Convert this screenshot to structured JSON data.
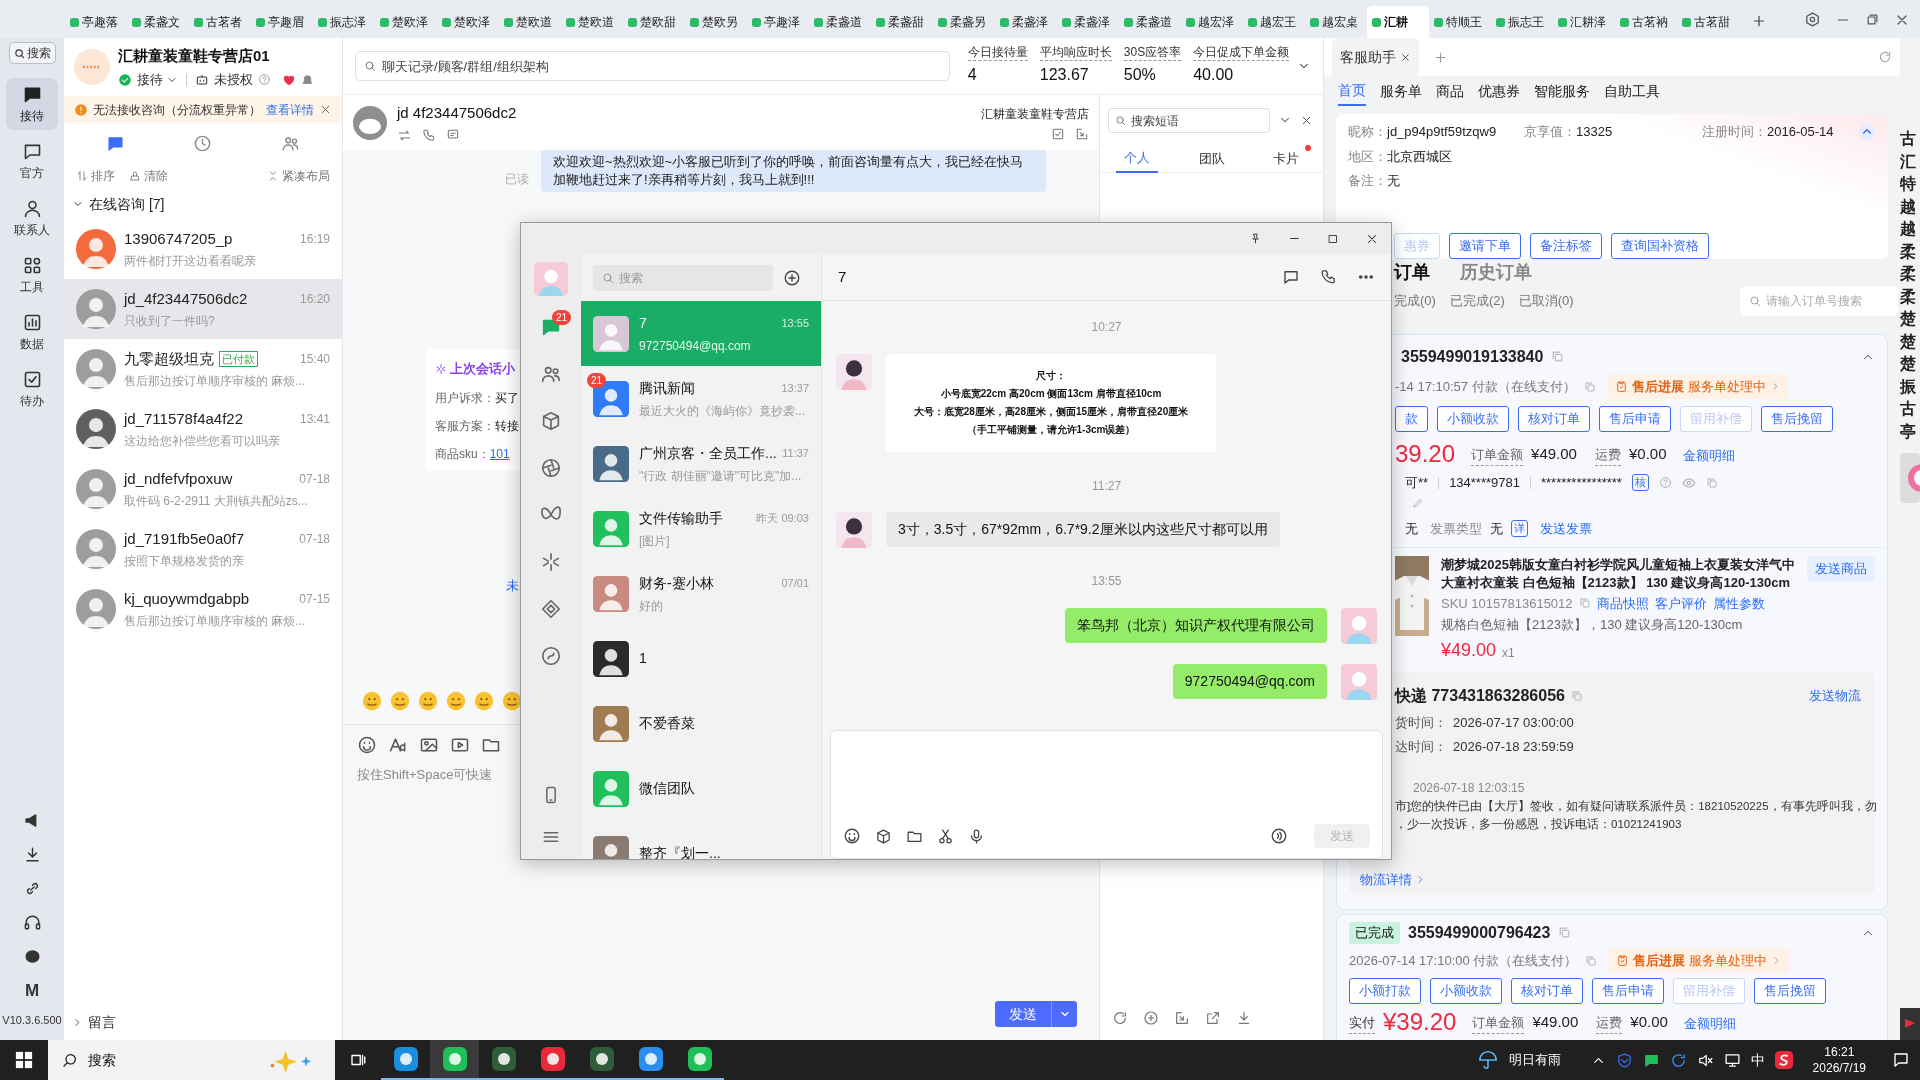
{
  "top_tabs": [
    {
      "label": "亭趣落",
      "selected": false
    },
    {
      "label": "柔盏文",
      "selected": false
    },
    {
      "label": "古茗者",
      "selected": false
    },
    {
      "label": "亭趣眉",
      "selected": false
    },
    {
      "label": "振志泽",
      "selected": false
    },
    {
      "label": "楚欧泽",
      "selected": false
    },
    {
      "label": "楚欧泽",
      "selected": false
    },
    {
      "label": "楚欧道",
      "selected": false
    },
    {
      "label": "楚欧道",
      "selected": false
    },
    {
      "label": "楚欧甜",
      "selected": false
    },
    {
      "label": "楚欧另",
      "selected": false
    },
    {
      "label": "亭趣泽",
      "selected": false
    },
    {
      "label": "柔盏道",
      "selected": false
    },
    {
      "label": "柔盏甜",
      "selected": false
    },
    {
      "label": "柔盏另",
      "selected": false
    },
    {
      "label": "柔盏泽",
      "selected": false
    },
    {
      "label": "柔盏泽",
      "selected": false
    },
    {
      "label": "柔盏道",
      "selected": false
    },
    {
      "label": "越宏泽",
      "selected": false
    },
    {
      "label": "越宏王",
      "selected": false
    },
    {
      "label": "越宏桌",
      "selected": false
    },
    {
      "label": "汇耕",
      "selected": true
    },
    {
      "label": "特顺王",
      "selected": false
    },
    {
      "label": "振志王",
      "selected": false
    },
    {
      "label": "汇耕泽",
      "selected": false
    },
    {
      "label": "古茗衲",
      "selected": false
    },
    {
      "label": "古茗甜",
      "selected": false
    }
  ],
  "rail": {
    "search": "搜索",
    "items": [
      {
        "label": "接待",
        "selected": true
      },
      {
        "label": "官方",
        "selected": false
      },
      {
        "label": "联系人",
        "selected": false
      },
      {
        "label": "工具",
        "selected": false
      },
      {
        "label": "数据",
        "selected": false
      },
      {
        "label": "待办",
        "selected": false
      }
    ],
    "logo_letter": "M",
    "version": "V10.3.6.500"
  },
  "shop": {
    "name": "汇耕童装童鞋专营店01",
    "status": "接待",
    "auth": "未授权"
  },
  "alert": {
    "text": "无法接收咨询（分流权重异常）",
    "link": "查看详情"
  },
  "list_tabs": [
    {
      "selected": true
    },
    {
      "selected": false
    },
    {
      "selected": false
    }
  ],
  "list_actions": [
    "排序",
    "清除",
    "紧凑布局"
  ],
  "section": {
    "label": "在线咨询 [7]",
    "expanded": true
  },
  "conversations": [
    {
      "name": "13906747205_p",
      "time": "16:19",
      "preview": "两件都打开这边看看呢亲",
      "selected": false,
      "color": "#f46a3c"
    },
    {
      "name": "jd_4f23447506dc2",
      "time": "16:20",
      "preview": "只收到了一件吗?",
      "selected": true,
      "color": "#9d9d9d"
    },
    {
      "name": "九零超级坦克",
      "tag": "已付款",
      "time": "15:40",
      "preview": "售后那边按订单顺序审核的 麻烦...",
      "selected": false,
      "color": "#9d9d9d"
    },
    {
      "name": "jd_711578f4a4f22",
      "time": "13:41",
      "preview": "这边给您补偿些您看可以吗亲",
      "selected": false,
      "color": "#5f5f5f"
    },
    {
      "name": "jd_ndfefvfpoxuw",
      "time": "07-18",
      "preview": "取件码 6-2-2911 大荆镇共配站zs...",
      "selected": false,
      "color": "#9d9d9d"
    },
    {
      "name": "jd_7191fb5e0a0f7",
      "time": "07-18",
      "preview": "按照下单规格发货的亲",
      "selected": false,
      "color": "#9d9d9d"
    },
    {
      "name": "kj_quoywmdgabpb",
      "time": "07-15",
      "preview": "售后那边按订单顺序审核的 麻烦...",
      "selected": false,
      "color": "#9d9d9d"
    }
  ],
  "leave_message": "留言",
  "top_search": {
    "placeholder": "聊天记录/顾客/群组/组织架构"
  },
  "stats": [
    {
      "label": "今日接待量",
      "value": "4"
    },
    {
      "label": "平均响应时长",
      "value": "123.67"
    },
    {
      "label": "30S应答率",
      "value": "50%"
    },
    {
      "label": "今日促成下单金额",
      "value": "40.00"
    }
  ],
  "chat": {
    "customer": "jd 4f23447506dc2",
    "shop": "汇耕童装童鞋专营店",
    "welcome": "欢迎欢迎~热烈欢迎~小客服已听到了你的呼唤，前面咨询量有点大，我已经在快马加鞭地赶过来了!亲再稍等片刻，我马上就到!!!",
    "read": "已读",
    "last_session": {
      "title": "上次会话小",
      "lines": [
        {
          "label": "用户诉求：",
          "value": "买了"
        },
        {
          "label": "客服方案：",
          "value": "转接"
        },
        {
          "label": "商品sku：",
          "value": "101"
        }
      ]
    },
    "fragment": "未",
    "placeholder": "按住Shift+Space可快速",
    "send": "发送"
  },
  "quick": {
    "placeholder": "搜索短语",
    "tabs": [
      {
        "label": "个人",
        "selected": true,
        "badge": false
      },
      {
        "label": "团队",
        "selected": false,
        "badge": false
      },
      {
        "label": "卡片",
        "selected": false,
        "badge": true
      }
    ]
  },
  "assistant": {
    "tab": "客服助手",
    "nav": [
      {
        "label": "首页",
        "selected": true
      },
      {
        "label": "服务单",
        "selected": false
      },
      {
        "label": "商品",
        "selected": false
      },
      {
        "label": "优惠券",
        "selected": false
      },
      {
        "label": "智能服务",
        "selected": false
      },
      {
        "label": "自助工具",
        "selected": false
      }
    ],
    "profile": [
      {
        "label": "昵称：",
        "value": "jd_p94p9tf59tzqw9"
      },
      {
        "label": "京享值：",
        "value": "13325"
      },
      {
        "label": "注册时间：",
        "value": "2016-05-14"
      },
      {
        "label": "地区：",
        "value": "北京西城区"
      },
      {
        "label": "备注：",
        "value": "无"
      }
    ],
    "actions": [
      "惠券",
      "邀请下单",
      "备注标签",
      "查询国补资格"
    ],
    "order_tabs": [
      {
        "label": "订单",
        "selected": true
      },
      {
        "label": "历史订单",
        "selected": false
      }
    ],
    "filters": [
      "完成(0)",
      "已完成(2)",
      "已取消(0)"
    ],
    "order_search": {
      "placeholder": "请输入订单号搜索"
    },
    "orders": [
      {
        "number": "3559499019133840",
        "paid": "-14 17:10:57 付款（在线支付）",
        "progress": {
          "label": "售后进展",
          "value": "服务单处理中"
        },
        "buttons": [
          {
            "label": "款",
            "disabled": false
          },
          {
            "label": "小额收款",
            "disabled": false
          },
          {
            "label": "核对订单",
            "disabled": false
          },
          {
            "label": "售后申请",
            "disabled": false
          },
          {
            "label": "留用补偿",
            "disabled": true
          },
          {
            "label": "售后挽留",
            "disabled": false
          }
        ],
        "amount": "39.20",
        "total_label": "订单金额",
        "total": "¥49.00",
        "freight_label": "运费",
        "freight": "¥0.00",
        "detail": "金额明细",
        "contact": {
          "name": "可**",
          "phone": "134****9781",
          "address": "****************",
          "verify": "核"
        },
        "invoice": {
          "value": "无",
          "type_label": "发票类型",
          "type": "无",
          "detail": "详",
          "send": "发送发票"
        },
        "product": {
          "title": "潮梦城2025韩版女童白衬衫学院风儿童短袖上衣夏装女洋气中大童衬衣童装 白色短袖【2123款】 130 建议身高120-130cm",
          "send": "发送商品",
          "sku": "SKU 10157813615012",
          "links": [
            "商品快照",
            "客户评价",
            "属性参数"
          ],
          "spec": "规格白色短袖【2123款】，130 建议身高120-130cm",
          "price": "¥49.00",
          "qty": "x1"
        },
        "logistics": {
          "title": "快递 773431863286056",
          "send": "发送物流",
          "rows": [
            {
              "label": "货时间：",
              "value": "2026-07-17 03:00:00"
            },
            {
              "label": "达时间：",
              "value": "2026-07-18 23:59:59"
            }
          ],
          "latest_time": "2026-07-18 12:03:15",
          "latest": [
            "市]您的快件已由【大厅】签收，如有疑问请联系派件员：18210520225，有事先呼叫我，勿",
            "，少一次投诉，多一份感恩，投诉电话：01021241903"
          ],
          "more": "物流详情"
        }
      },
      {
        "status": "已完成",
        "number": "3559499000796423",
        "paid": "2026-07-14 17:10:00 付款（在线支付）",
        "progress": {
          "label": "售后进展",
          "value": "服务单处理中"
        },
        "buttons": [
          {
            "label": "小额打款",
            "disabled": false
          },
          {
            "label": "小额收款",
            "disabled": false
          },
          {
            "label": "核对订单",
            "disabled": false
          },
          {
            "label": "售后申请",
            "disabled": false
          },
          {
            "label": "留用补偿",
            "disabled": true
          },
          {
            "label": "售后挽留",
            "disabled": false
          }
        ],
        "amount_label": "实付",
        "amount": "¥39.20",
        "total_label": "订单金额",
        "total": "¥49.00",
        "freight_label": "运费",
        "freight": "¥0.00",
        "detail": "金额明细"
      }
    ]
  },
  "edge_tabs": [
    "古",
    "汇",
    "特",
    "越",
    "越",
    "柔",
    "柔",
    "柔",
    "楚",
    "楚",
    "楚",
    "振",
    "古",
    "亭"
  ],
  "wechat": {
    "rail": [
      {
        "selected": true,
        "badge": "21"
      },
      {
        "selected": false
      },
      {
        "selected": false
      },
      {
        "selected": false
      },
      {
        "selected": false
      },
      {
        "selected": false
      },
      {
        "selected": false
      },
      {
        "selected": false
      }
    ],
    "search": {
      "placeholder": "搜索"
    },
    "chats": [
      {
        "name": "7",
        "time": "13:55",
        "preview": "972750494@qq.com",
        "selected": true,
        "color": "#d9c7d8"
      },
      {
        "name": "腾讯新闻",
        "time": "13:37",
        "preview": "最近大火的《海屿你》竟抄袭...",
        "selected": false,
        "badge": "21",
        "color": "#2f7cf6"
      },
      {
        "name": "广州京客・全员工作...",
        "time": "11:37",
        "preview": "\"行政 胡佳丽\"邀请\"可比克\"加...",
        "selected": false,
        "color": "#4a6a8a"
      },
      {
        "name": "文件传输助手",
        "time": "昨天 09:03",
        "preview": "[图片]",
        "selected": false,
        "color": "#20c05c"
      },
      {
        "name": "财务-蹇小林",
        "time": "07/01",
        "preview": "好的",
        "selected": false,
        "color": "#c98a80"
      },
      {
        "name": "1",
        "selected": false,
        "color": "#2a2a2a"
      },
      {
        "name": "不爱香菜",
        "selected": false,
        "color": "#a07a50"
      },
      {
        "name": "微信团队",
        "selected": false,
        "color": "#20c05c"
      },
      {
        "name": "整齐『划一...",
        "selected": false,
        "color": "#8a7a70"
      }
    ],
    "title": "7",
    "messages": [
      {
        "kind": "time",
        "text": "10:27"
      },
      {
        "kind": "card",
        "outgoing": false,
        "lines": [
          "尺寸：",
          "小号底宽22cm 高20cm 侧面13cm 肩带直径10cm",
          "大号：底宽28厘米，高28厘米，侧面15厘米，肩带直径20厘米",
          "（手工平铺测量，请允许1-3cm误差）"
        ]
      },
      {
        "kind": "time",
        "text": "11:27"
      },
      {
        "kind": "text",
        "outgoing": false,
        "text": "3寸，3.5寸，67*92mm，6.7*9.2厘米以内这些尺寸都可以用"
      },
      {
        "kind": "time",
        "text": "13:55"
      },
      {
        "kind": "text",
        "outgoing": true,
        "text": "笨鸟邦（北京）知识产权代理有限公司"
      },
      {
        "kind": "text",
        "outgoing": true,
        "text": "972750494@qq.com"
      }
    ],
    "send": {
      "label": "发送",
      "disabled": true
    }
  },
  "taskbar": {
    "search": "搜索",
    "apps": [
      {
        "active": false
      },
      {
        "active": true
      },
      {
        "active": false
      },
      {
        "active": false
      },
      {
        "active": false
      },
      {
        "active": false
      },
      {
        "active": false
      }
    ],
    "weather": "明日有雨",
    "ime": "中",
    "time": "16:21",
    "date": "2026/7/19"
  }
}
